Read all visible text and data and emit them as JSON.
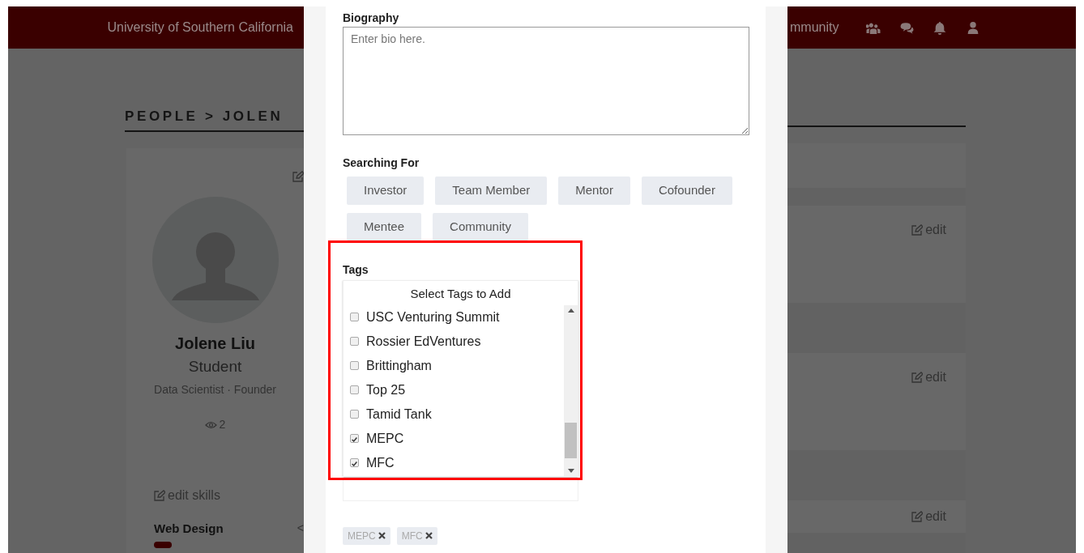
{
  "navbar": {
    "brand": "University of Southern California",
    "link": "mmunity"
  },
  "breadcrumb": "PEOPLE > JOLEN",
  "profile": {
    "name": "Jolene Liu",
    "role": "Student",
    "titles": "Data Scientist · Founder",
    "views": "2",
    "edit_skills": "edit skills",
    "skills": [
      {
        "name": "Web Design",
        "level_text": "<"
      }
    ]
  },
  "sections": [
    {
      "edit": "edit"
    },
    {
      "edit": "edit"
    },
    {
      "edit": "edit"
    }
  ],
  "modal": {
    "biography": {
      "label": "Biography",
      "placeholder": "Enter bio here."
    },
    "searching_for": {
      "label": "Searching For",
      "options": [
        {
          "label": "Investor"
        },
        {
          "label": "Team Member"
        },
        {
          "label": "Mentor"
        },
        {
          "label": "Cofounder"
        },
        {
          "label": "Mentee"
        },
        {
          "label": "Community"
        }
      ]
    },
    "tags": {
      "label": "Tags",
      "dropdown_title": "Select Tags to Add",
      "options": [
        {
          "label": "USC Venturing Summit",
          "checked": false
        },
        {
          "label": "Rossier EdVentures",
          "checked": false
        },
        {
          "label": "Brittingham",
          "checked": false
        },
        {
          "label": "Top 25",
          "checked": false
        },
        {
          "label": "Tamid Tank",
          "checked": false
        },
        {
          "label": "MEPC",
          "checked": true
        },
        {
          "label": "MFC",
          "checked": true
        }
      ],
      "selected": [
        {
          "label": "MEPC"
        },
        {
          "label": "MFC"
        }
      ]
    }
  }
}
